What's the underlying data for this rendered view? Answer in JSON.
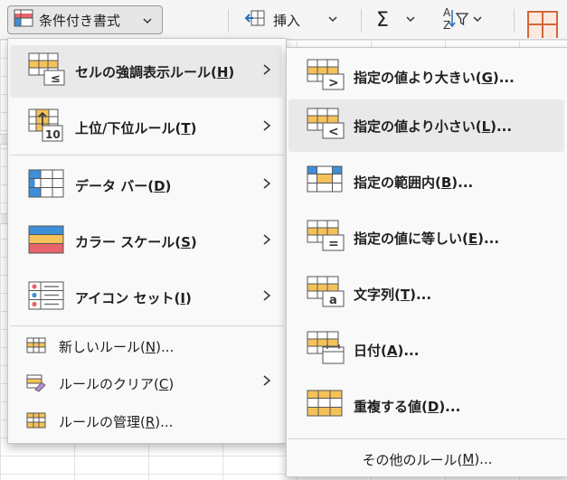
{
  "toolbar": {
    "conditional_formatting_label": "条件付き書式",
    "insert_label": "挿入",
    "sum_symbol": "Σ",
    "sort_filter_icon": "sort-filter-icon"
  },
  "main_menu": {
    "items": [
      {
        "label": "セルの強調表示ルール(",
        "key": "H",
        "tail": ")",
        "icon": "highlight-cells-icon",
        "has_submenu": true
      },
      {
        "label": "上位/下位ルール(",
        "key": "T",
        "tail": ")",
        "icon": "top-bottom-icon",
        "has_submenu": true
      },
      {
        "label": "データ バー(",
        "key": "D",
        "tail": ")",
        "icon": "data-bars-icon",
        "has_submenu": true
      },
      {
        "label": "カラー スケール(",
        "key": "S",
        "tail": ")",
        "icon": "color-scales-icon",
        "has_submenu": true
      },
      {
        "label": "アイコン セット(",
        "key": "I",
        "tail": ")",
        "icon": "icon-sets-icon",
        "has_submenu": true
      }
    ],
    "commands": [
      {
        "label": "新しいルール(",
        "key": "N",
        "tail": ")...",
        "icon": "new-rule-icon"
      },
      {
        "label": "ルールのクリア(",
        "key": "C",
        "tail": ")",
        "icon": "clear-rules-icon"
      },
      {
        "label": "ルールの管理(",
        "key": "R",
        "tail": ")...",
        "icon": "manage-rules-icon"
      }
    ],
    "top_bottom_badge": "10"
  },
  "sub_menu": {
    "items": [
      {
        "label": "指定の値より大きい(",
        "key": "G",
        "tail": ")...",
        "icon": "greater-than-icon",
        "symbol": ">"
      },
      {
        "label": "指定の値より小さい(",
        "key": "L",
        "tail": ")...",
        "icon": "less-than-icon",
        "symbol": "<"
      },
      {
        "label": "指定の範囲内(",
        "key": "B",
        "tail": ")...",
        "icon": "between-icon"
      },
      {
        "label": "指定の値に等しい(",
        "key": "E",
        "tail": ")...",
        "icon": "equal-to-icon",
        "symbol": "="
      },
      {
        "label": "文字列(",
        "key": "T",
        "tail": ")...",
        "icon": "text-contains-icon",
        "symbol": "a"
      },
      {
        "label": "日付(",
        "key": "A",
        "tail": ")...",
        "icon": "date-occurring-icon"
      },
      {
        "label": "重複する値(",
        "key": "D",
        "tail": ")...",
        "icon": "duplicate-values-icon"
      }
    ],
    "footer": {
      "label": "その他のルール(",
      "key": "M",
      "tail": ")..."
    }
  },
  "colors": {
    "accent_orange": "#f5c25a",
    "accent_red": "#e8636b",
    "accent_blue": "#3d8fd8",
    "menu_bg": "#f9f9f9",
    "hover_bg": "#e9e9e9"
  }
}
